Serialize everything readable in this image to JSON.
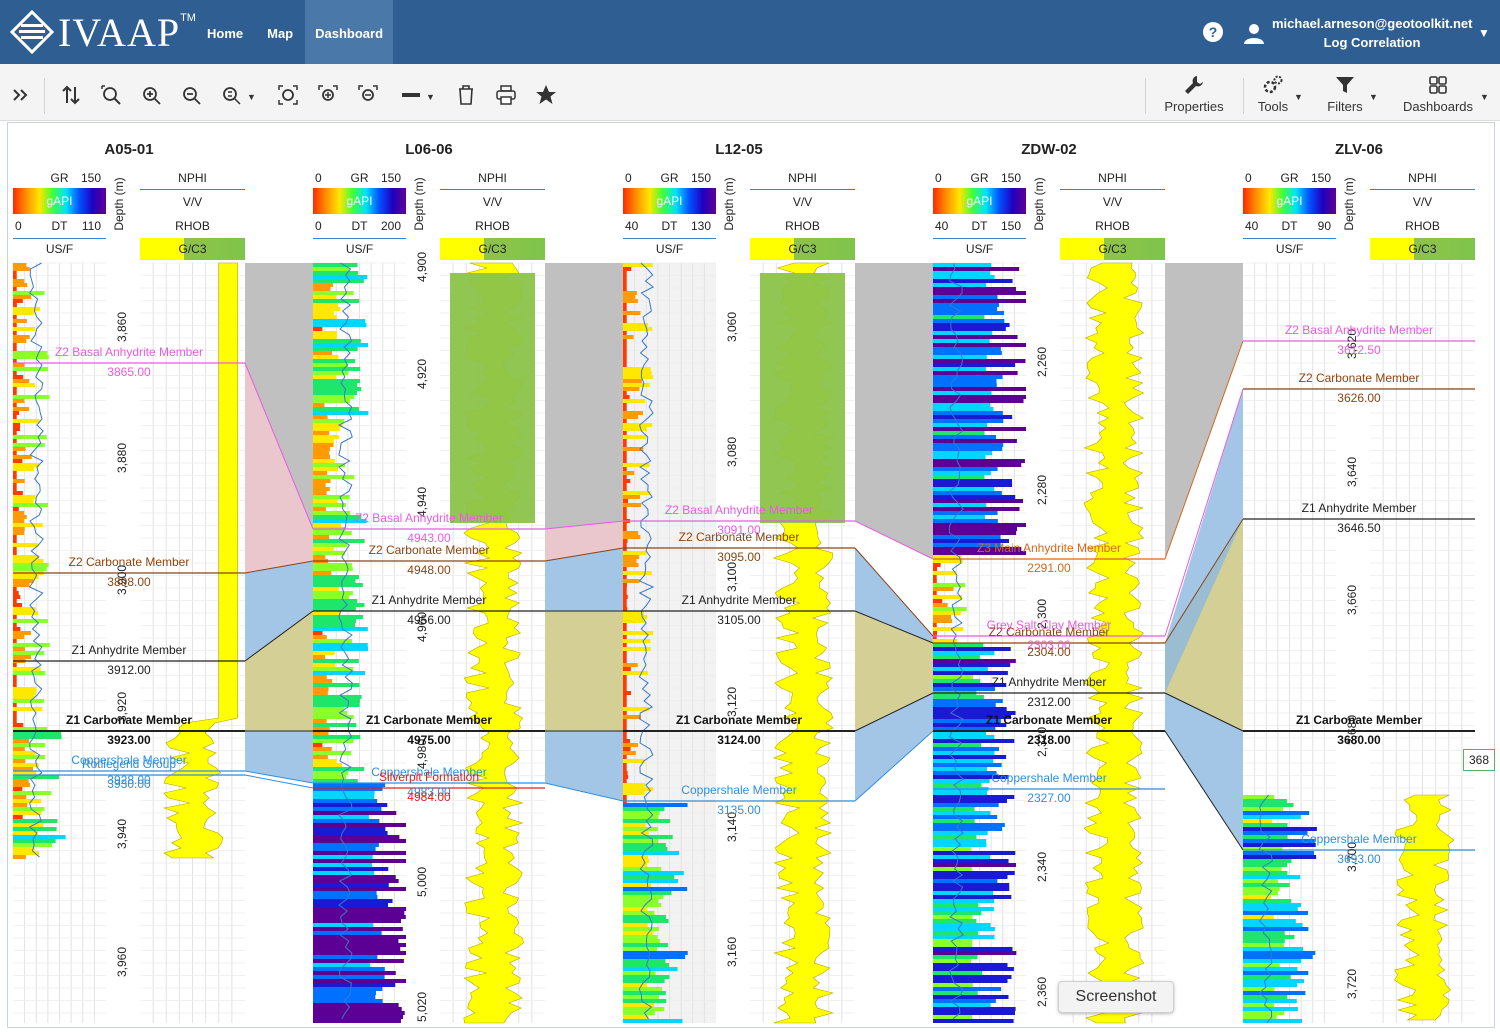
{
  "header": {
    "logo_text": "IVAAP",
    "logo_tm": "TM",
    "nav": [
      {
        "label": "Home",
        "active": false
      },
      {
        "label": "Map",
        "active": false
      },
      {
        "label": "Dashboard",
        "active": true
      }
    ],
    "help_label": "?",
    "user_email": "michael.arneson@geotoolkit.net",
    "dashboard_name": "Log Correlation"
  },
  "toolbar": {
    "expand_icon": "double-chevron-right-icon",
    "right_buttons": [
      {
        "label": "Properties",
        "icon": "wrench-icon"
      },
      {
        "label": "Tools",
        "icon": "gears-icon"
      },
      {
        "label": "Filters",
        "icon": "funnel-icon"
      },
      {
        "label": "Dashboards",
        "icon": "grid-icon"
      }
    ]
  },
  "colors": {
    "header_bg": "#2f5f92",
    "active_tab_bg": "#4a79a9",
    "formation_pink": "#e85ce0",
    "formation_brown": "#8b4513",
    "formation_blue": "#2f8fe0",
    "formation_red": "#e02020",
    "rhob_yellow": "#ffff00",
    "nphi_green": "#8cc34a",
    "panel_fill_grey": "#c0c0c0",
    "panel_fill_blue": "#8db8e0",
    "panel_fill_olive": "#c8c37a"
  },
  "wells": [
    {
      "name": "A05-01",
      "gr": {
        "min": "",
        "mnem": "GR",
        "max": "150",
        "unit": "gAPI"
      },
      "dt": {
        "min": "0",
        "mnem": "DT",
        "max": "110",
        "unit": "US/F"
      },
      "depth_label": "Depth (m)",
      "right": {
        "top": "NPHI",
        "unit1": "V/V",
        "mnem2": "RHOB",
        "unit2": "G/C3"
      },
      "depth_ticks": [
        "3,860",
        "3,880",
        "3,900",
        "3,920",
        "3,940",
        "3,960"
      ],
      "formations": [
        {
          "name": "Z2 Basal Anhydrite Member",
          "depth": "3865.00",
          "color": "#e85ce0",
          "bold": false
        },
        {
          "name": "Z2 Carbonate Member",
          "depth": "3898.00",
          "color": "#8b4513",
          "bold": false
        },
        {
          "name": "Z1 Anhydrite Member",
          "depth": "3912.00",
          "color": "#222222",
          "bold": false
        },
        {
          "name": "Z1 Carbonate Member",
          "depth": "3923.00",
          "color": "#222222",
          "bold": true
        },
        {
          "name": "Coppershale Member",
          "depth": "3928.00",
          "color": "#2f8fe0",
          "bold": false
        },
        {
          "name": "Rotliegend Group",
          "depth": "3930.00",
          "color": "#2f8fe0",
          "bold": false
        }
      ]
    },
    {
      "name": "L06-06",
      "gr": {
        "min": "0",
        "mnem": "GR",
        "max": "150",
        "unit": "gAPI"
      },
      "dt": {
        "min": "0",
        "mnem": "DT",
        "max": "200",
        "unit": "US/F"
      },
      "depth_label": "Depth (m)",
      "right": {
        "top": "NPHI",
        "unit1": "V/V",
        "mnem2": "RHOB",
        "unit2": "G/C3"
      },
      "depth_ticks": [
        "4,900",
        "4,920",
        "4,940",
        "4,960",
        "4,980",
        "5,000",
        "5,020"
      ],
      "formations": [
        {
          "name": "Z2 Basal Anhydrite Member",
          "depth": "4943.00",
          "color": "#e85ce0",
          "bold": false
        },
        {
          "name": "Z2 Carbonate Member",
          "depth": "4948.00",
          "color": "#8b4513",
          "bold": false
        },
        {
          "name": "Z1 Anhydrite Member",
          "depth": "4956.00",
          "color": "#222222",
          "bold": false
        },
        {
          "name": "Z1 Carbonate Member",
          "depth": "4975.00",
          "color": "#222222",
          "bold": true
        },
        {
          "name": "Coppershale Member",
          "depth": "4983.00",
          "color": "#2f8fe0",
          "bold": false
        },
        {
          "name": "Silverpit Formation",
          "depth": "4984.00",
          "color": "#e02020",
          "bold": false
        }
      ]
    },
    {
      "name": "L12-05",
      "gr": {
        "min": "0",
        "mnem": "GR",
        "max": "150",
        "unit": "gAPI"
      },
      "dt": {
        "min": "40",
        "mnem": "DT",
        "max": "130",
        "unit": "US/F"
      },
      "depth_label": "Depth (m)",
      "right": {
        "top": "NPHI",
        "unit1": "V/V",
        "mnem2": "RHOB",
        "unit2": "G/C3"
      },
      "depth_ticks": [
        "3,060",
        "3,080",
        "3,100",
        "3,120",
        "3,140",
        "3,160"
      ],
      "formations": [
        {
          "name": "Z2 Basal Anhydrite Member",
          "depth": "3091.00",
          "color": "#e85ce0",
          "bold": false
        },
        {
          "name": "Z2 Carbonate Member",
          "depth": "3095.00",
          "color": "#8b4513",
          "bold": false
        },
        {
          "name": "Z1 Anhydrite Member",
          "depth": "3105.00",
          "color": "#222222",
          "bold": false
        },
        {
          "name": "Z1 Carbonate Member",
          "depth": "3124.00",
          "color": "#222222",
          "bold": true
        },
        {
          "name": "Coppershale Member",
          "depth": "3135.00",
          "color": "#2f8fe0",
          "bold": false
        }
      ]
    },
    {
      "name": "ZDW-02",
      "gr": {
        "min": "0",
        "mnem": "GR",
        "max": "150",
        "unit": "gAPI"
      },
      "dt": {
        "min": "40",
        "mnem": "DT",
        "max": "150",
        "unit": "US/F"
      },
      "depth_label": "Depth (m)",
      "right": {
        "top": "NPHI",
        "unit1": "V/V",
        "mnem2": "RHOB",
        "unit2": "G/C3"
      },
      "depth_ticks": [
        "2,260",
        "2,280",
        "2,300",
        "2,320",
        "2,340",
        "2,360"
      ],
      "formations": [
        {
          "name": "Z3 Main Anhydrite Member",
          "depth": "2291.00",
          "color": "#d2691e",
          "bold": false
        },
        {
          "name": "Grey Salt Clay Member",
          "depth": "2303.00",
          "color": "#e85ce0",
          "bold": false
        },
        {
          "name": "Z2 Carbonate Member",
          "depth": "2304.00",
          "color": "#8b4513",
          "bold": false
        },
        {
          "name": "Z1 Anhydrite Member",
          "depth": "2312.00",
          "color": "#222222",
          "bold": false
        },
        {
          "name": "Z1 Carbonate Member",
          "depth": "2318.00",
          "color": "#222222",
          "bold": true
        },
        {
          "name": "Coppershale Member",
          "depth": "2327.00",
          "color": "#2f8fe0",
          "bold": false
        }
      ]
    },
    {
      "name": "ZLV-06",
      "gr": {
        "min": "0",
        "mnem": "GR",
        "max": "150",
        "unit": "gAPI"
      },
      "dt": {
        "min": "40",
        "mnem": "DT",
        "max": "90",
        "unit": "US/F"
      },
      "depth_label": "Depth (m)",
      "right": {
        "top": "NPHI",
        "unit1": "V/V",
        "mnem2": "RHOB",
        "unit2": "G/C3"
      },
      "depth_ticks": [
        "3,620",
        "3,640",
        "3,660",
        "3,680",
        "3,700",
        "3,720"
      ],
      "formations": [
        {
          "name": "Z2 Basal Anhydrite Member",
          "depth": "3612.50",
          "color": "#e85ce0",
          "bold": false
        },
        {
          "name": "Z2 Carbonate Member",
          "depth": "3626.00",
          "color": "#8b4513",
          "bold": false
        },
        {
          "name": "Z1 Anhydrite Member",
          "depth": "3646.50",
          "color": "#222222",
          "bold": false
        },
        {
          "name": "Z1 Carbonate Member",
          "depth": "3680.00",
          "color": "#222222",
          "bold": true
        },
        {
          "name": "Coppershale Member",
          "depth": "3693.00",
          "color": "#2f8fe0",
          "bold": false
        }
      ]
    }
  ],
  "tooltip": "Screenshot",
  "side_badge": "368"
}
